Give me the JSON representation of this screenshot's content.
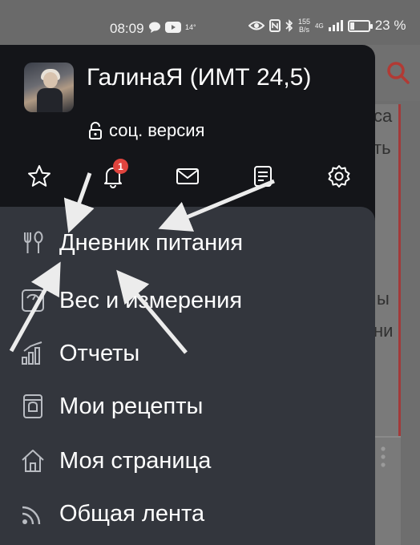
{
  "status_bar": {
    "time": "08:09",
    "notif_temp": "14°",
    "net_speed_value": "155",
    "net_speed_unit": "B/s",
    "net_type": "4G",
    "battery_percent": "23 %",
    "battery_level": 0.23
  },
  "profile": {
    "name": "ГалинаЯ (ИМТ 24,5)",
    "version_label": "соц. версия"
  },
  "top_icons": [
    {
      "name": "star-icon"
    },
    {
      "name": "bell-icon",
      "badge": "1"
    },
    {
      "name": "mail-icon"
    },
    {
      "name": "notes-icon"
    },
    {
      "name": "gear-icon"
    }
  ],
  "menu": {
    "items": [
      {
        "label": "Дневник питания",
        "icon": "fork-spoon-icon"
      },
      {
        "label": "Вес и измерения",
        "icon": "scale-icon"
      },
      {
        "label": "Отчеты",
        "icon": "bar-chart-icon"
      },
      {
        "label": "Мои рецепты",
        "icon": "recipe-book-icon"
      },
      {
        "label": "Моя страница",
        "icon": "home-icon"
      },
      {
        "label": "Общая лента",
        "icon": "feed-icon"
      }
    ]
  },
  "background": {
    "fragments": [
      "са",
      "ть",
      "ы",
      "ни"
    ]
  },
  "colors": {
    "drawer_bg": "#141519",
    "menu_panel_bg": "#33363d",
    "badge": "#e0443e",
    "accent_red": "#c0392b"
  }
}
